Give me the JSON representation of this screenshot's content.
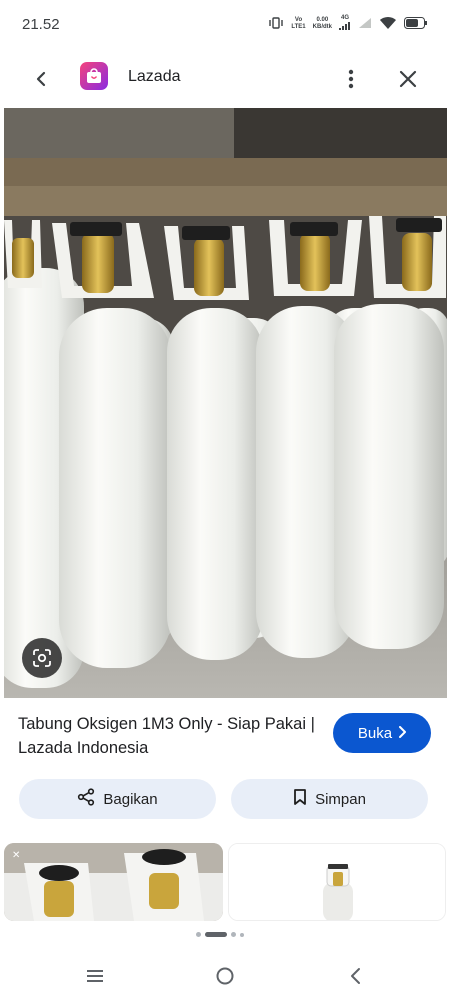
{
  "status_bar": {
    "time": "21.52",
    "network_label_top": "Vo",
    "network_label_bottom": "LTE1",
    "speed_value": "0.00",
    "speed_unit": "KB/dtk",
    "signal_type": "4G",
    "icons": [
      "vibrate-icon",
      "signal-icon",
      "signal-icon",
      "wifi-icon",
      "battery-icon"
    ]
  },
  "top_bar": {
    "site_name": "Lazada",
    "icons": [
      "back-arrow-icon",
      "lazada-logo-icon",
      "more-vert-icon",
      "close-icon"
    ]
  },
  "result": {
    "title": "Tabung Oksigen 1M3 Only - Siap Pakai | Lazada Indonesia",
    "visit_label": "Buka",
    "share_label": "Bagikan",
    "save_label": "Simpan"
  },
  "nav_bar": {
    "icons": [
      "recent-apps-icon",
      "home-icon",
      "back-icon"
    ]
  },
  "colors": {
    "accent": "#0b57d0",
    "chip_bg": "#e8eef8",
    "brand_logo": "#f5437b"
  }
}
